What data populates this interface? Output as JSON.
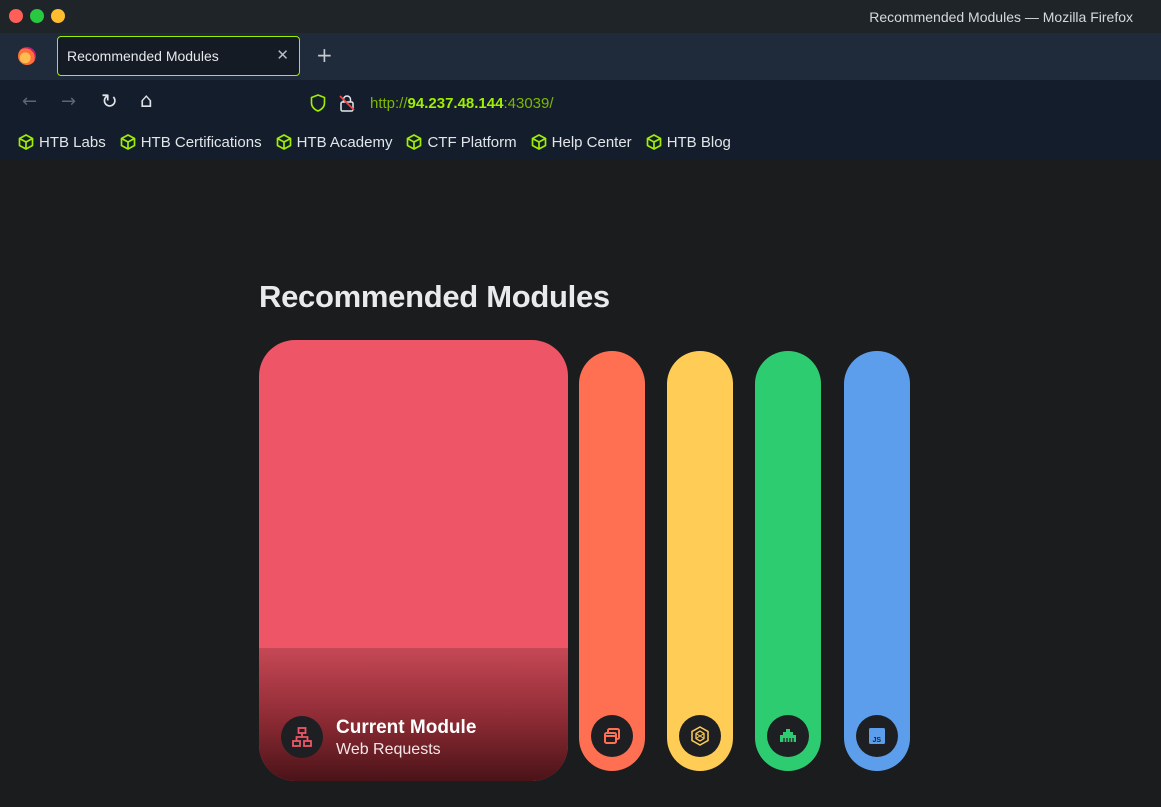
{
  "window": {
    "title": "Recommended Modules — Mozilla Firefox",
    "traffic_lights": [
      "#ff5f57",
      "#28c840",
      "#febc2e"
    ]
  },
  "tab": {
    "label": "Recommended Modules",
    "close": "✕",
    "new_tab": "+"
  },
  "nav": {
    "back": "←",
    "forward": "→",
    "reload": "↻",
    "home": "⌂",
    "url_protocol": "http://",
    "url_host": "94.237.48.144",
    "url_port": ":43039/"
  },
  "bookmarks": [
    {
      "label": "HTB Labs",
      "icon": "htb-cube-icon"
    },
    {
      "label": "HTB Certifications",
      "icon": "htb-cube-icon"
    },
    {
      "label": "HTB Academy",
      "icon": "htb-cube-icon"
    },
    {
      "label": "CTF Platform",
      "icon": "htb-cube-icon"
    },
    {
      "label": "Help Center",
      "icon": "htb-cube-icon"
    },
    {
      "label": "HTB Blog",
      "icon": "htb-cube-icon"
    }
  ],
  "page": {
    "heading": "Recommended Modules",
    "current_module": {
      "title": "Current Module",
      "subtitle": "Web Requests",
      "color": "#ee5566",
      "icon": "network-icon"
    },
    "modules": [
      {
        "color": "#ff6f52",
        "icon": "windows-icon"
      },
      {
        "color": "#ffcd55",
        "icon": "hexagon-icon"
      },
      {
        "color": "#2ecc71",
        "icon": "ethernet-icon"
      },
      {
        "color": "#5c9eec",
        "icon": "js-icon"
      }
    ]
  }
}
